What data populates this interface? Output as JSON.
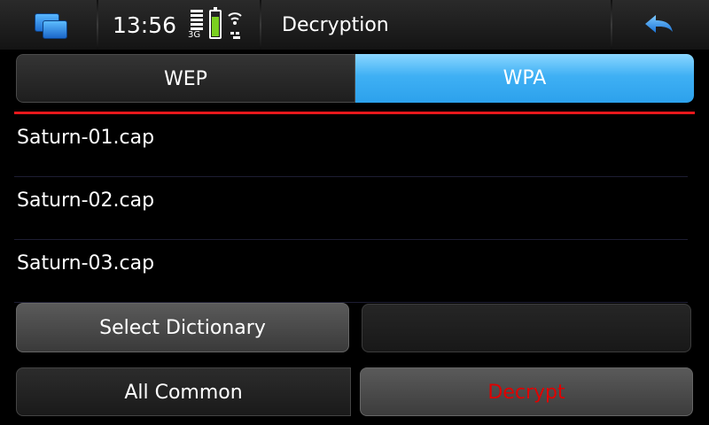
{
  "status_bar": {
    "clock": "13:56",
    "network_type": "3G",
    "battery_level": 0.75,
    "icons": [
      "task-switcher-icon",
      "signal-icon",
      "battery-icon",
      "wifi-icon"
    ]
  },
  "header": {
    "title": "Decryption",
    "back_icon": "back-arrow-icon"
  },
  "tabs": [
    {
      "label": "WEP",
      "selected": false
    },
    {
      "label": "WPA",
      "selected": true
    }
  ],
  "files": [
    {
      "name": "Saturn-01.cap"
    },
    {
      "name": "Saturn-02.cap"
    },
    {
      "name": "Saturn-03.cap"
    }
  ],
  "dictionary": {
    "select_label": "Select Dictionary",
    "value": ""
  },
  "actions": {
    "all_common_label": "All Common",
    "decrypt_label": "Decrypt"
  },
  "colors": {
    "accent": "#2ca1ec",
    "separator": "#e8181c",
    "decrypt_text": "#e00000",
    "battery": "#7bd020"
  }
}
